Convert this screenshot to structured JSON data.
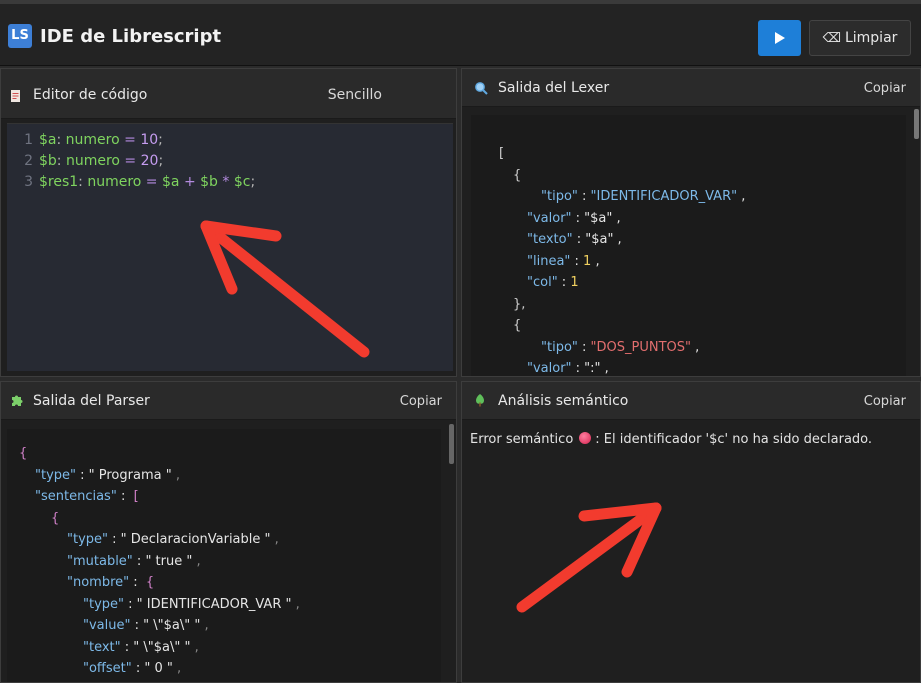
{
  "app": {
    "logo": "LS",
    "title": "IDE de Librescript"
  },
  "toolbar": {
    "clear_label": "Limpiar",
    "clear_icon": "⌫",
    "run_icon": "play-icon"
  },
  "editor": {
    "title": "Editor de código",
    "mode": "Sencillo",
    "lines": [
      {
        "n": "1",
        "var": "$a",
        "colon": ":",
        "type": "numero",
        "eq": "=",
        "rest": [
          [
            "num",
            "10"
          ],
          [
            "punc",
            ";"
          ]
        ]
      },
      {
        "n": "2",
        "var": "$b",
        "colon": ":",
        "type": "numero",
        "eq": "=",
        "rest": [
          [
            "num",
            "20"
          ],
          [
            "punc",
            ";"
          ]
        ]
      },
      {
        "n": "3",
        "var": "$res1",
        "colon": ":",
        "type": "numero",
        "eq": "=",
        "rest": [
          [
            "green",
            "$a"
          ],
          [
            "op",
            "+"
          ],
          [
            "green",
            "$b"
          ],
          [
            "op",
            "*"
          ],
          [
            "green",
            "$c"
          ],
          [
            "punc",
            ";"
          ]
        ]
      }
    ]
  },
  "lexer": {
    "title": "Salida del Lexer",
    "copy": "Copiar",
    "lines": [
      {
        "indent": 0,
        "parts": [
          [
            "b",
            "["
          ]
        ]
      },
      {
        "indent": 1,
        "parts": [
          [
            "b",
            "{"
          ]
        ]
      },
      {
        "indent": 3,
        "parts": [
          [
            "k",
            "\"tipo\""
          ],
          [
            "s",
            " : "
          ],
          [
            "k",
            "\"IDENTIFICADOR_VAR\""
          ],
          [
            "s",
            " ,"
          ]
        ]
      },
      {
        "indent": 2,
        "parts": [
          [
            "k",
            "\"valor\""
          ],
          [
            "s",
            " : \"$a\" ,"
          ]
        ]
      },
      {
        "indent": 2,
        "parts": [
          [
            "k",
            "\"texto\""
          ],
          [
            "s",
            " : \"$a\" ,"
          ]
        ]
      },
      {
        "indent": 2,
        "parts": [
          [
            "k",
            "\"linea\""
          ],
          [
            "s",
            " : "
          ],
          [
            "n",
            "1"
          ],
          [
            "s",
            " ,"
          ]
        ]
      },
      {
        "indent": 2,
        "parts": [
          [
            "k",
            "\"col\""
          ],
          [
            "s",
            " : "
          ],
          [
            "n",
            "1"
          ]
        ]
      },
      {
        "indent": 1,
        "parts": [
          [
            "b",
            "},"
          ]
        ]
      },
      {
        "indent": 1,
        "parts": [
          [
            "b",
            "{"
          ]
        ]
      },
      {
        "indent": 3,
        "parts": [
          [
            "k",
            "\"tipo\""
          ],
          [
            "s",
            " : "
          ],
          [
            "r",
            "\"DOS_PUNTOS\""
          ],
          [
            "s",
            " ,"
          ]
        ]
      },
      {
        "indent": 2,
        "parts": [
          [
            "k",
            "\"valor\""
          ],
          [
            "s",
            " : \":\" ,"
          ]
        ]
      }
    ]
  },
  "parser": {
    "title": "Salida del Parser",
    "copy": "Copiar",
    "lines": [
      {
        "indent": 0,
        "parts": [
          [
            "pk",
            "{"
          ]
        ]
      },
      {
        "indent": 1,
        "parts": [
          [
            "k",
            "\"type\""
          ],
          [
            "s",
            " : \" Programa \" "
          ],
          [
            "cm",
            ","
          ]
        ]
      },
      {
        "indent": 1,
        "parts": [
          [
            "k",
            "\"sentencias\""
          ],
          [
            "s",
            " :  "
          ],
          [
            "pk",
            "["
          ]
        ]
      },
      {
        "indent": 2,
        "parts": [
          [
            "pk",
            "{"
          ]
        ]
      },
      {
        "indent": 3,
        "parts": [
          [
            "k",
            "\"type\""
          ],
          [
            "s",
            " : \" DeclaracionVariable \" "
          ],
          [
            "cm",
            ","
          ]
        ]
      },
      {
        "indent": 3,
        "parts": [
          [
            "k",
            "\"mutable\""
          ],
          [
            "s",
            " : \" true \" "
          ],
          [
            "cm",
            ","
          ]
        ]
      },
      {
        "indent": 3,
        "parts": [
          [
            "k",
            "\"nombre\""
          ],
          [
            "s",
            " :  "
          ],
          [
            "pk",
            "{"
          ]
        ]
      },
      {
        "indent": 4,
        "parts": [
          [
            "k",
            "\"type\""
          ],
          [
            "s",
            " : \" IDENTIFICADOR_VAR \" "
          ],
          [
            "cm",
            ","
          ]
        ]
      },
      {
        "indent": 4,
        "parts": [
          [
            "k",
            "\"value\""
          ],
          [
            "s",
            " : \" \\\"$a\\\" \" "
          ],
          [
            "cm",
            ","
          ]
        ]
      },
      {
        "indent": 4,
        "parts": [
          [
            "k",
            "\"text\""
          ],
          [
            "s",
            " : \" \\\"$a\\\" \" "
          ],
          [
            "cm",
            ","
          ]
        ]
      },
      {
        "indent": 4,
        "parts": [
          [
            "k",
            "\"offset\""
          ],
          [
            "s",
            " : \" 0 \" "
          ],
          [
            "cm",
            ","
          ]
        ]
      }
    ]
  },
  "semantic": {
    "title": "Análisis semántico",
    "copy": "Copiar",
    "error_prefix": "Error semántico",
    "error_message": ": El identificador '$c' no ha sido declarado."
  },
  "annotation_color": "#f23b2e",
  "colors": {
    "accent": "#1e7fd8",
    "logo": "#3d7fd6"
  }
}
